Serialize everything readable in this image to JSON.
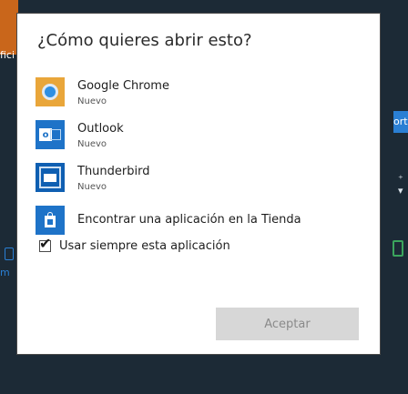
{
  "dialog": {
    "title": "¿Cómo quieres abrir esto?",
    "apps": [
      {
        "name": "Google Chrome",
        "subtitle": "Nuevo",
        "icon": "chrome-icon"
      },
      {
        "name": "Outlook",
        "subtitle": "Nuevo",
        "icon": "outlook-icon"
      },
      {
        "name": "Thunderbird",
        "subtitle": "Nuevo",
        "icon": "thunderbird-icon"
      }
    ],
    "store_link": "Encontrar una aplicación en la Tienda",
    "store_icon": "store-icon",
    "always_use": {
      "label": "Usar siempre esta aplicación",
      "checked": true
    },
    "accept_label": "Aceptar"
  },
  "background": {
    "left_text": "fici",
    "left_link": "m",
    "right_bar_text": "ortar",
    "right_chevron": "⁺ ▾"
  },
  "colors": {
    "dialog_bg": "#ffffff",
    "accent_blue": "#1e73c8",
    "button_disabled_bg": "#d7d7d7",
    "button_disabled_text": "#8a8a8a"
  }
}
